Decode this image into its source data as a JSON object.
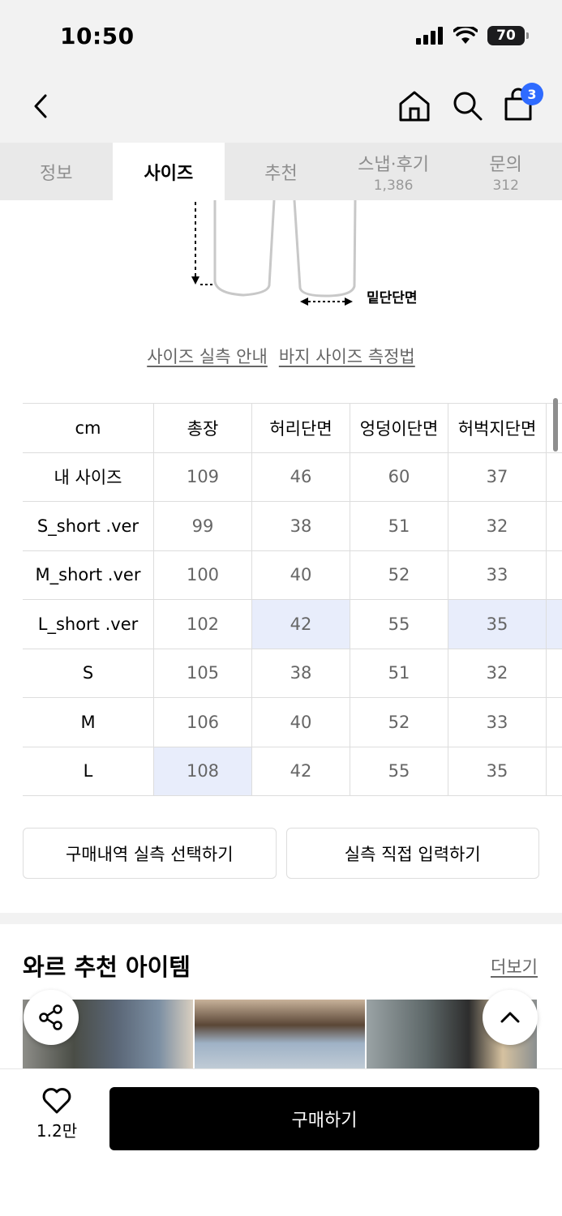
{
  "status": {
    "time": "10:50",
    "battery": "70"
  },
  "header": {
    "cart_count": "3"
  },
  "tabs": [
    {
      "label": "정보",
      "sub": ""
    },
    {
      "label": "사이즈",
      "sub": ""
    },
    {
      "label": "추천",
      "sub": ""
    },
    {
      "label": "스냅·후기",
      "sub": "1,386"
    },
    {
      "label": "문의",
      "sub": "312"
    }
  ],
  "diagram": {
    "hem_label": "밑단단면"
  },
  "links": {
    "guide": "사이즈 실측 안내",
    "howto": "바지 사이즈 측정법"
  },
  "table": {
    "headers": [
      "cm",
      "총장",
      "허리단면",
      "엉덩이단면",
      "허벅지단면"
    ],
    "rows": [
      [
        "내 사이즈",
        "109",
        "46",
        "60",
        "37"
      ],
      [
        "S_short .ver",
        "99",
        "38",
        "51",
        "32"
      ],
      [
        "M_short .ver",
        "100",
        "40",
        "52",
        "33"
      ],
      [
        "L_short .ver",
        "102",
        "42",
        "55",
        "35"
      ],
      [
        "S",
        "105",
        "38",
        "51",
        "32"
      ],
      [
        "M",
        "106",
        "40",
        "52",
        "33"
      ],
      [
        "L",
        "108",
        "42",
        "55",
        "35"
      ]
    ]
  },
  "buttons": {
    "history": "구매내역 실측 선택하기",
    "manual": "실측 직접 입력하기"
  },
  "recommend": {
    "title": "와르 추천 아이템",
    "more": "더보기"
  },
  "bottom": {
    "likes": "1.2만",
    "buy": "구매하기"
  },
  "colors": {
    "accent": "#2f6bff",
    "highlight": "#e8edfb"
  }
}
